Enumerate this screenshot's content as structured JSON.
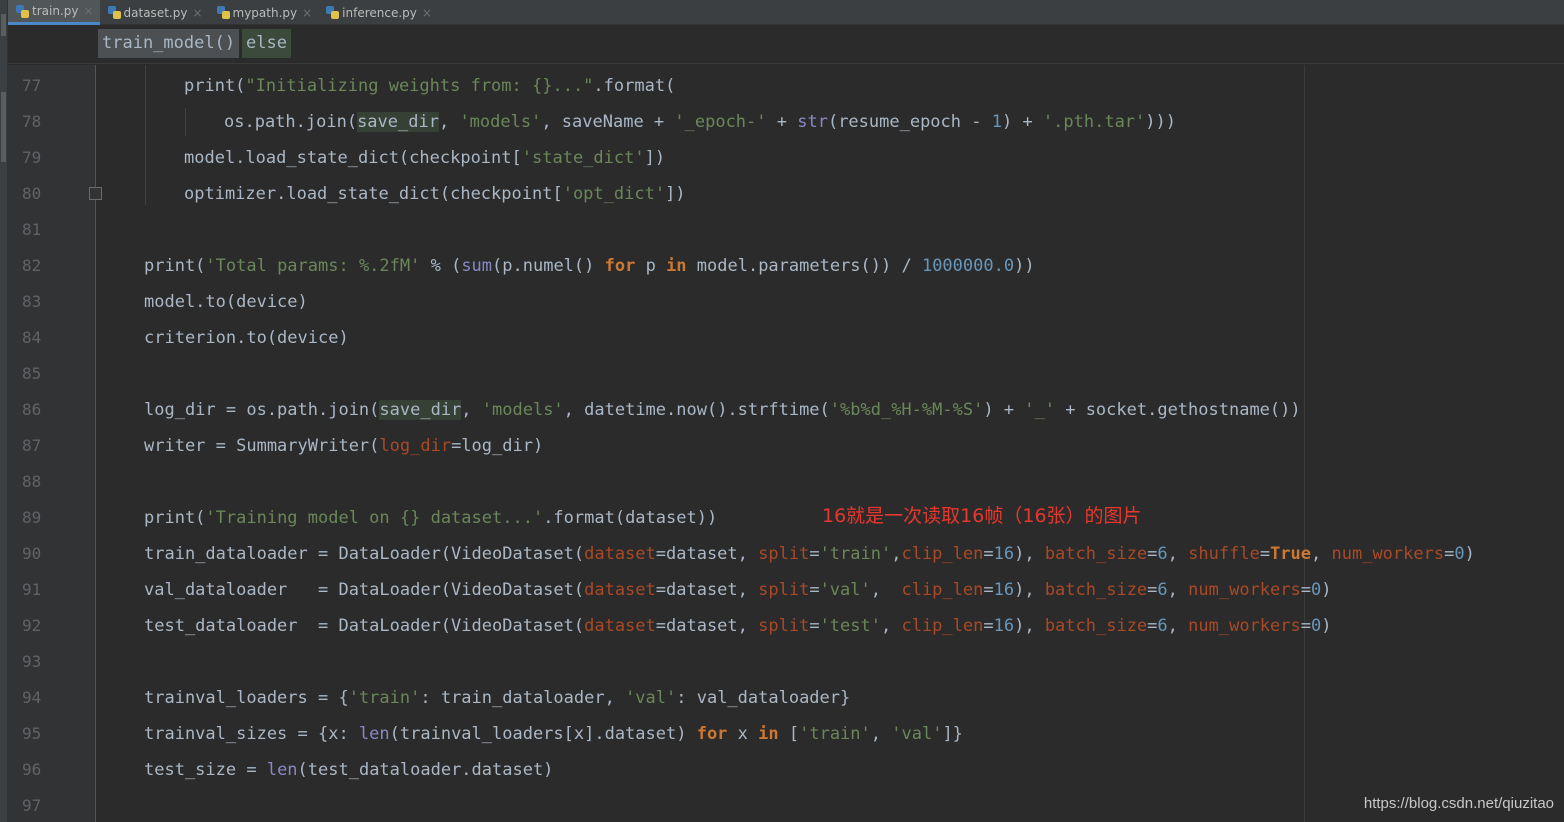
{
  "tabs": [
    {
      "label": "train.py",
      "active": true
    },
    {
      "label": "dataset.py",
      "active": false
    },
    {
      "label": "mypath.py",
      "active": false
    },
    {
      "label": "inference.py",
      "active": false
    }
  ],
  "close_glyph": "×",
  "breadcrumb": [
    "train_model()",
    "else"
  ],
  "line_numbers": [
    "77",
    "78",
    "79",
    "80",
    "81",
    "82",
    "83",
    "84",
    "85",
    "86",
    "87",
    "88",
    "89",
    "90",
    "91",
    "92",
    "93",
    "94",
    "95",
    "96",
    "97"
  ],
  "code_lines": [
    [
      [
        "",
        "print("
      ],
      [
        "s",
        "\"Initializing weights from: {}...\""
      ],
      [
        "",
        ".format("
      ]
    ],
    [
      [
        "",
        "os.path.join("
      ],
      [
        "hl",
        "save_dir"
      ],
      [
        "",
        ", "
      ],
      [
        "s",
        "'models'"
      ],
      [
        "",
        ", saveName + "
      ],
      [
        "s",
        "'_epoch-'"
      ],
      [
        "",
        " + "
      ],
      [
        "b",
        "str"
      ],
      [
        "",
        "(resume_epoch - "
      ],
      [
        "n",
        "1"
      ],
      [
        "",
        ") + "
      ],
      [
        "s",
        "'.pth.tar'"
      ],
      [
        "",
        ")))"
      ]
    ],
    [
      [
        "",
        "model.load_state_dict(checkpoint["
      ],
      [
        "s",
        "'state_dict'"
      ],
      [
        "",
        "])"
      ]
    ],
    [
      [
        "",
        "optimizer.load_state_dict(checkpoint["
      ],
      [
        "s",
        "'opt_dict'"
      ],
      [
        "",
        "])"
      ]
    ],
    [],
    [
      [
        "",
        "print("
      ],
      [
        "s",
        "'Total params: %.2fM'"
      ],
      [
        "",
        " % ("
      ],
      [
        "b",
        "sum"
      ],
      [
        "",
        "(p.numel() "
      ],
      [
        "k",
        "for"
      ],
      [
        "",
        " p "
      ],
      [
        "k",
        "in"
      ],
      [
        "",
        " model.parameters()) / "
      ],
      [
        "n",
        "1000000.0"
      ],
      [
        "",
        "))"
      ]
    ],
    [
      [
        "",
        "model.to(device)"
      ]
    ],
    [
      [
        "",
        "criterion.to(device)"
      ]
    ],
    [],
    [
      [
        "",
        "log_dir = os.path.join("
      ],
      [
        "hl",
        "save_dir"
      ],
      [
        "",
        ", "
      ],
      [
        "s",
        "'models'"
      ],
      [
        "",
        ", datetime.now().strftime("
      ],
      [
        "s",
        "'%b%d_%H-%M-%S'"
      ],
      [
        "",
        ") + "
      ],
      [
        "s",
        "'_'"
      ],
      [
        "",
        " + socket.gethostname())"
      ]
    ],
    [
      [
        "",
        "writer = SummaryWriter("
      ],
      [
        "p",
        "log_dir"
      ],
      [
        "",
        "=log_dir)"
      ]
    ],
    [],
    [
      [
        "",
        "print("
      ],
      [
        "s",
        "'Training model on {} dataset...'"
      ],
      [
        "",
        ".format(dataset))"
      ]
    ],
    [
      [
        "",
        "train_dataloader = DataLoader(VideoDataset("
      ],
      [
        "p",
        "dataset"
      ],
      [
        "",
        "=dataset, "
      ],
      [
        "p",
        "split"
      ],
      [
        "",
        "="
      ],
      [
        "s",
        "'train'"
      ],
      [
        "",
        ","
      ],
      [
        "p",
        "clip_len"
      ],
      [
        "",
        "="
      ],
      [
        "n",
        "16"
      ],
      [
        "",
        "), "
      ],
      [
        "p",
        "batch_size"
      ],
      [
        "",
        "="
      ],
      [
        "n",
        "6"
      ],
      [
        "",
        ", "
      ],
      [
        "p",
        "shuffle"
      ],
      [
        "",
        "="
      ],
      [
        "k",
        "True"
      ],
      [
        "",
        ", "
      ],
      [
        "p",
        "num_workers"
      ],
      [
        "",
        "="
      ],
      [
        "n",
        "0"
      ],
      [
        "",
        ")"
      ]
    ],
    [
      [
        "",
        "val_dataloader   = DataLoader(VideoDataset("
      ],
      [
        "p",
        "dataset"
      ],
      [
        "",
        "=dataset, "
      ],
      [
        "p",
        "split"
      ],
      [
        "",
        "="
      ],
      [
        "s",
        "'val'"
      ],
      [
        "",
        ",  "
      ],
      [
        "p",
        "clip_len"
      ],
      [
        "",
        "="
      ],
      [
        "n",
        "16"
      ],
      [
        "",
        "), "
      ],
      [
        "p",
        "batch_size"
      ],
      [
        "",
        "="
      ],
      [
        "n",
        "6"
      ],
      [
        "",
        ", "
      ],
      [
        "p",
        "num_workers"
      ],
      [
        "",
        "="
      ],
      [
        "n",
        "0"
      ],
      [
        "",
        ")"
      ]
    ],
    [
      [
        "",
        "test_dataloader  = DataLoader(VideoDataset("
      ],
      [
        "p",
        "dataset"
      ],
      [
        "",
        "=dataset, "
      ],
      [
        "p",
        "split"
      ],
      [
        "",
        "="
      ],
      [
        "s",
        "'test'"
      ],
      [
        "",
        ", "
      ],
      [
        "p",
        "clip_len"
      ],
      [
        "",
        "="
      ],
      [
        "n",
        "16"
      ],
      [
        "",
        "), "
      ],
      [
        "p",
        "batch_size"
      ],
      [
        "",
        "="
      ],
      [
        "n",
        "6"
      ],
      [
        "",
        ", "
      ],
      [
        "p",
        "num_workers"
      ],
      [
        "",
        "="
      ],
      [
        "n",
        "0"
      ],
      [
        "",
        ")"
      ]
    ],
    [],
    [
      [
        "",
        "trainval_loaders = {"
      ],
      [
        "s",
        "'train'"
      ],
      [
        "",
        ": train_dataloader, "
      ],
      [
        "s",
        "'val'"
      ],
      [
        "",
        ": val_dataloader}"
      ]
    ],
    [
      [
        "",
        "trainval_sizes = {x: "
      ],
      [
        "b",
        "len"
      ],
      [
        "",
        "(trainval_loaders[x].dataset) "
      ],
      [
        "k",
        "for"
      ],
      [
        "",
        " x "
      ],
      [
        "k",
        "in"
      ],
      [
        "",
        " ["
      ],
      [
        "s",
        "'train'"
      ],
      [
        "",
        ", "
      ],
      [
        "s",
        "'val'"
      ],
      [
        "",
        "]}"
      ]
    ],
    [
      [
        "",
        "test_size = "
      ],
      [
        "b",
        "len"
      ],
      [
        "",
        "(test_dataloader.dataset)"
      ]
    ],
    []
  ],
  "annotation": "16就是一次读取16帧（16张）的图片",
  "watermark": "https://blog.csdn.net/qiuzitao",
  "colors": {
    "background": "#2b2b2b",
    "keyword": "#cc7832",
    "string": "#6a8759",
    "number": "#6897bb",
    "builtin": "#8888c6",
    "param": "#aa4926",
    "annotation": "#e8372d"
  }
}
